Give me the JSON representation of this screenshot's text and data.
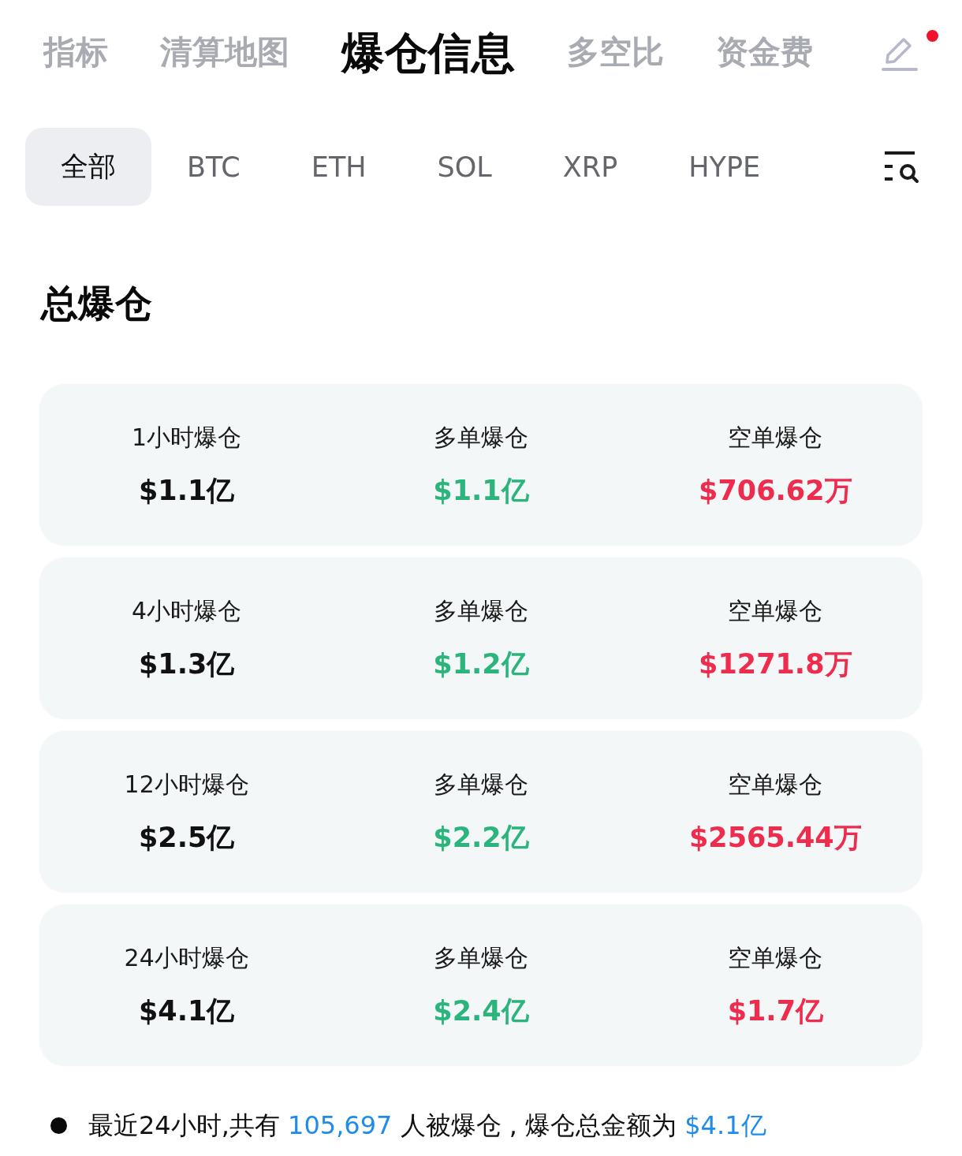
{
  "top_tabs": [
    {
      "label": "指标",
      "selected": false
    },
    {
      "label": "清算地图",
      "selected": false
    },
    {
      "label": "爆仓信息",
      "selected": true
    },
    {
      "label": "多空比",
      "selected": false
    },
    {
      "label": "资金费",
      "selected": false
    }
  ],
  "edit_button": {
    "notification_dot": true
  },
  "coin_filters": [
    {
      "label": "全部",
      "selected": true
    },
    {
      "label": "BTC",
      "selected": false
    },
    {
      "label": "ETH",
      "selected": false
    },
    {
      "label": "SOL",
      "selected": false
    },
    {
      "label": "XRP",
      "selected": false
    },
    {
      "label": "HYPE",
      "selected": false
    }
  ],
  "section_title": "总爆仓",
  "cards": [
    {
      "cells": [
        {
          "label": "1小时爆仓",
          "value": "$1.1亿",
          "color": "#111111"
        },
        {
          "label": "多单爆仓",
          "value": "$1.1亿",
          "color": "#2bb57c"
        },
        {
          "label": "空单爆仓",
          "value": "$706.62万",
          "color": "#ee2c4e"
        }
      ]
    },
    {
      "cells": [
        {
          "label": "4小时爆仓",
          "value": "$1.3亿",
          "color": "#111111"
        },
        {
          "label": "多单爆仓",
          "value": "$1.2亿",
          "color": "#2bb57c"
        },
        {
          "label": "空单爆仓",
          "value": "$1271.8万",
          "color": "#ee2c4e"
        }
      ]
    },
    {
      "cells": [
        {
          "label": "12小时爆仓",
          "value": "$2.5亿",
          "color": "#111111"
        },
        {
          "label": "多单爆仓",
          "value": "$2.2亿",
          "color": "#2bb57c"
        },
        {
          "label": "空单爆仓",
          "value": "$2565.44万",
          "color": "#ee2c4e"
        }
      ]
    },
    {
      "cells": [
        {
          "label": "24小时爆仓",
          "value": "$4.1亿",
          "color": "#111111"
        },
        {
          "label": "多单爆仓",
          "value": "$2.4亿",
          "color": "#2bb57c"
        },
        {
          "label": "空单爆仓",
          "value": "$1.7亿",
          "color": "#ee2c4e"
        }
      ]
    }
  ],
  "summary": {
    "parts": [
      {
        "text": "最近24小时,共有 ",
        "highlight": false
      },
      {
        "text": "105,697",
        "highlight": true
      },
      {
        "text": " 人被爆仓 , 爆仓总金额为 ",
        "highlight": false
      },
      {
        "text": "$4.1亿",
        "highlight": true
      }
    ]
  }
}
